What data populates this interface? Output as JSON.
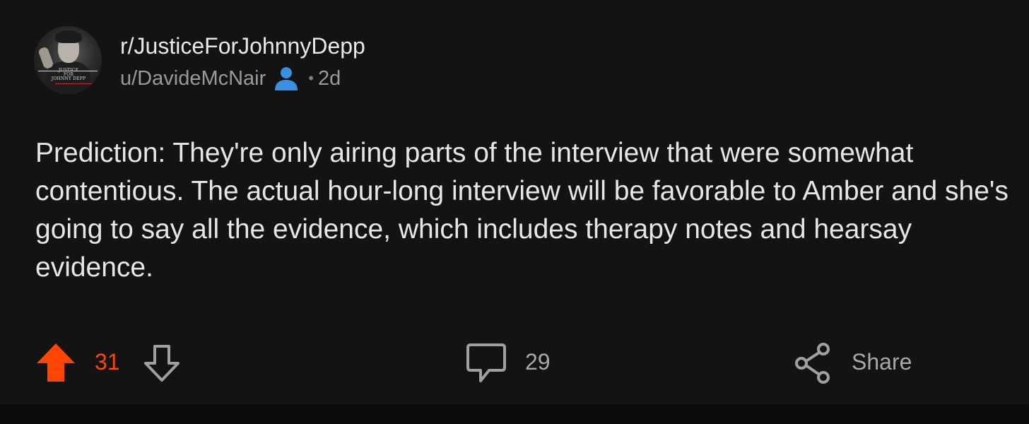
{
  "post": {
    "subreddit": "r/JusticeForJohnnyDepp",
    "author": "u/DavideMcNair",
    "separator": "•",
    "age": "2d",
    "avatar_text": [
      "JUSTICE",
      "FOR",
      "JOHNNY DEPP"
    ],
    "body": "Prediction: They're only airing parts of the interview that were somewhat contentious. The actual hour-long interview will be favorable to Amber and she's going to say all the evidence, which includes therapy notes and hearsay evidence."
  },
  "actions": {
    "upvote_count": "31",
    "comment_count": "29",
    "share_label": "Share"
  },
  "colors": {
    "upvote_active": "#ff4500",
    "user_icon": "#3b8fe0",
    "background": "#131313"
  },
  "icons": {
    "upvote": "upvote-arrow-icon",
    "downvote": "downvote-arrow-icon",
    "comment": "comment-bubble-icon",
    "share": "share-icon",
    "user": "user-icon"
  }
}
